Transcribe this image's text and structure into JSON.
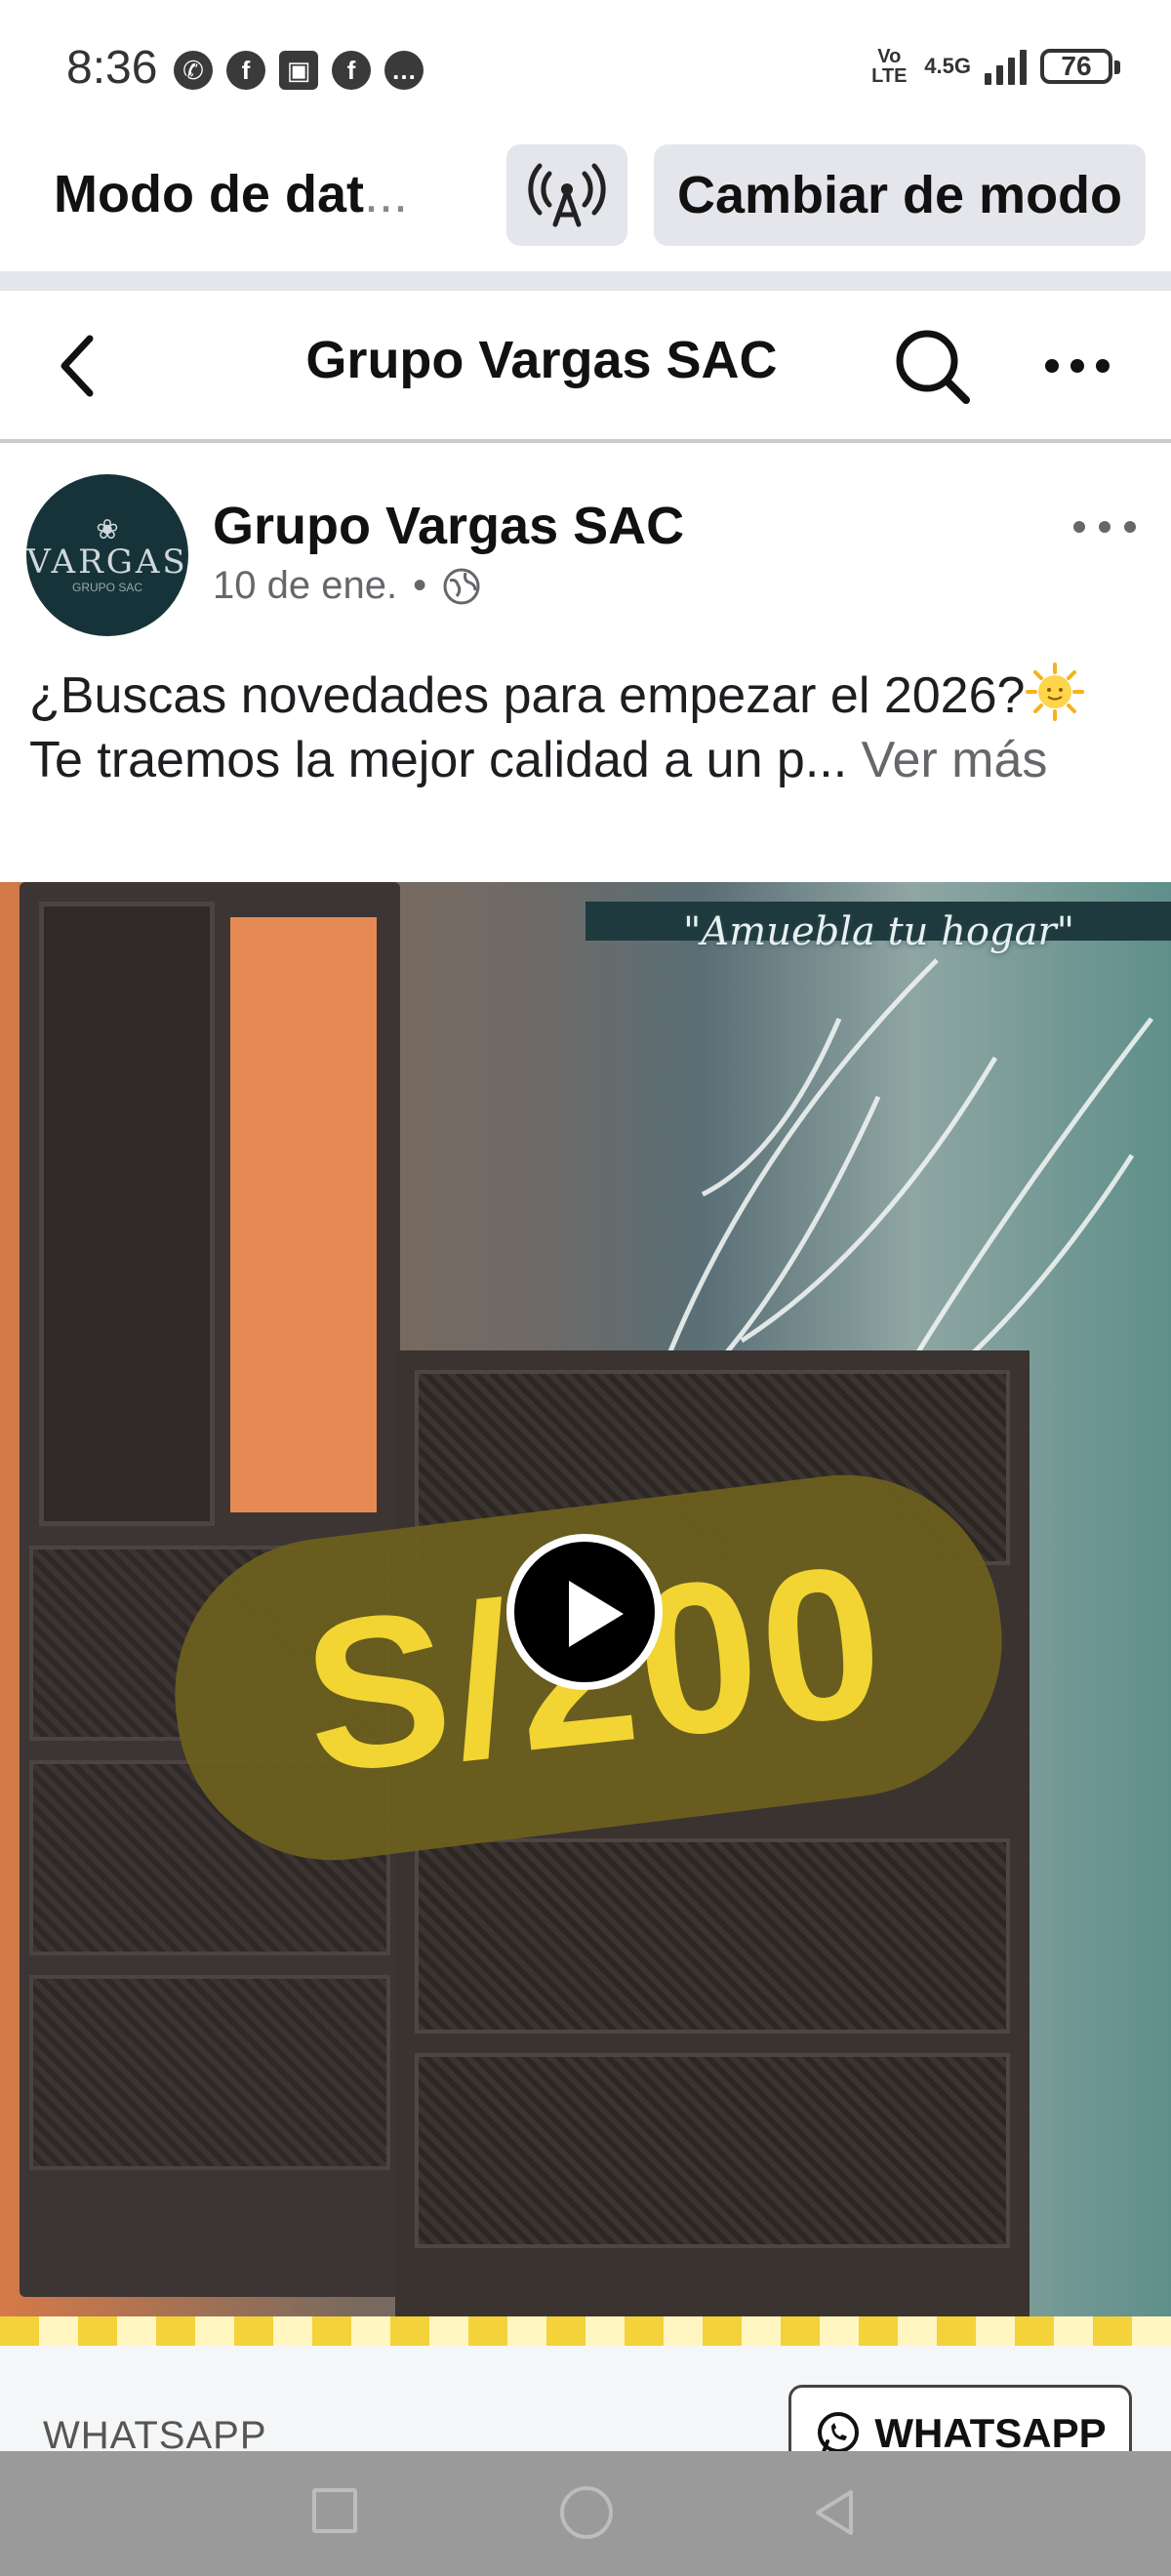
{
  "status_bar": {
    "time": "8:36",
    "network": "4.5G",
    "volte": "Vo LTE",
    "battery": "76",
    "notification_icons": [
      "whatsapp-icon",
      "facebook-icon",
      "contact-card-icon",
      "facebook-icon",
      "chat-bubble-icon"
    ]
  },
  "data_mode": {
    "title": "Modo de dat",
    "ellipsis": "...",
    "switch_label": "Cambiar de modo"
  },
  "page_header": {
    "title": "Grupo Vargas SAC"
  },
  "post": {
    "avatar_brand": "VARGAS",
    "avatar_sub": "GRUPO SAC",
    "author": "Grupo Vargas SAC",
    "date": "10 de ene.",
    "separator": "•",
    "text_line1": "¿Buscas novedades para empezar el 2026?",
    "text_line2": "Te traemos la mejor calidad a un p...",
    "see_more": "Ver más"
  },
  "video": {
    "tagline": "\"Amuebla tu hogar\"",
    "price": "S/200"
  },
  "cta": {
    "label": "WHATSAPP",
    "button_label": "WHATSAPP"
  },
  "colors": {
    "accent_gray": "#e4e6eb",
    "price_yellow": "#f2d533",
    "avatar_bg": "#16333a"
  }
}
